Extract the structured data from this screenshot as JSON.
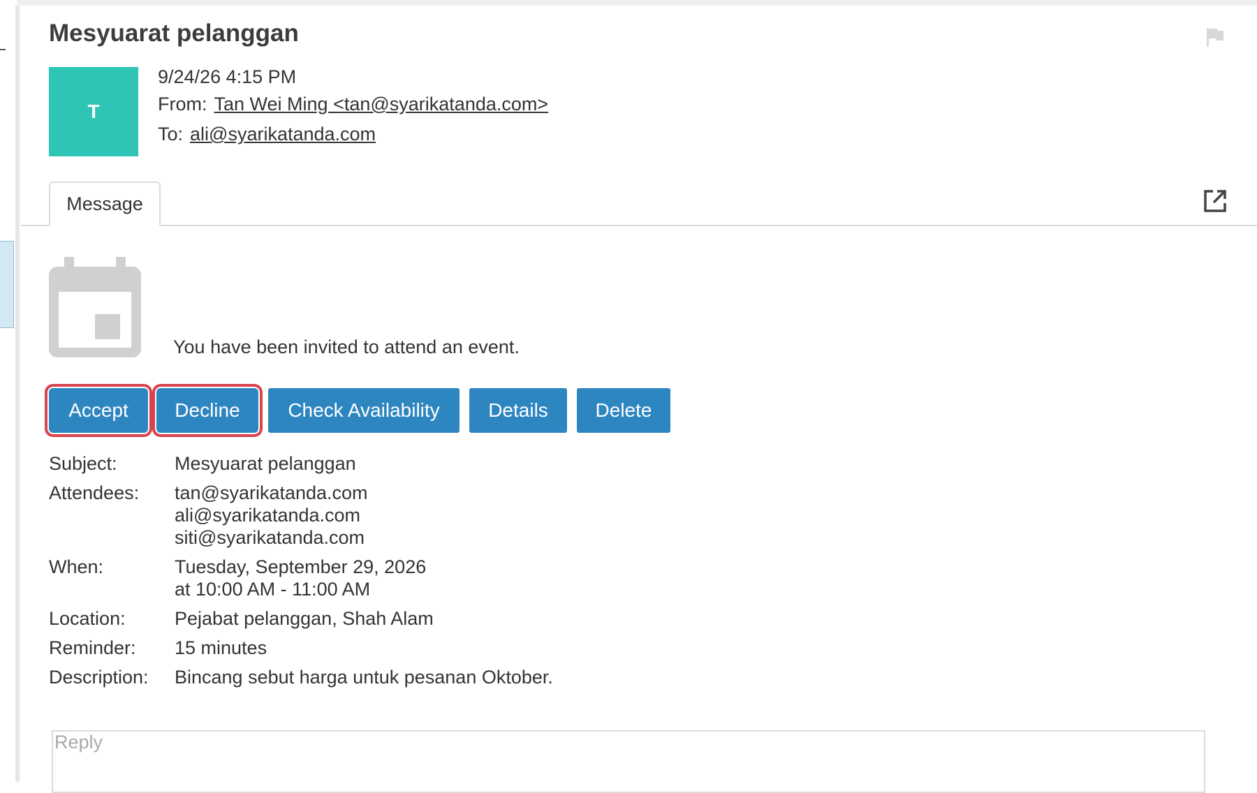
{
  "email": {
    "subject": "Mesyuarat pelanggan",
    "avatar_initial": "T",
    "date": "9/24/26 4:15 PM",
    "from_label": "From:",
    "from": "Tan Wei Ming <tan@syarikatanda.com>",
    "to_label": "To:",
    "to": "ali@syarikatanda.com"
  },
  "tabs": [
    {
      "label": "Message"
    }
  ],
  "invite": {
    "text": "You have been invited to attend an event.",
    "buttons": {
      "accept": "Accept",
      "decline": "Decline",
      "check_availability": "Check Availability",
      "details": "Details",
      "delete": "Delete"
    }
  },
  "event": {
    "subject_label": "Subject:",
    "subject": "Mesyuarat pelanggan",
    "attendees_label": "Attendees:",
    "attendees": [
      "tan@syarikatanda.com",
      "ali@syarikatanda.com",
      "siti@syarikatanda.com"
    ],
    "when_label": "When:",
    "when_date": "Tuesday, September 29, 2026",
    "when_time": "at 10:00 AM - 11:00 AM",
    "location_label": "Location:",
    "location": "Pejabat pelanggan, Shah Alam",
    "reminder_label": "Reminder:",
    "reminder": "15 minutes",
    "description_label": "Description:",
    "description": "Bincang sebut harga untuk pesanan Oktober."
  },
  "reply": {
    "placeholder": "Reply"
  },
  "icons": {
    "flag": "flag-icon",
    "popout": "open-in-new-window-icon",
    "calendar": "calendar-icon"
  },
  "colors": {
    "avatar": "#2ec4b6",
    "button": "#2e86c1",
    "highlight": "#d9434e"
  }
}
